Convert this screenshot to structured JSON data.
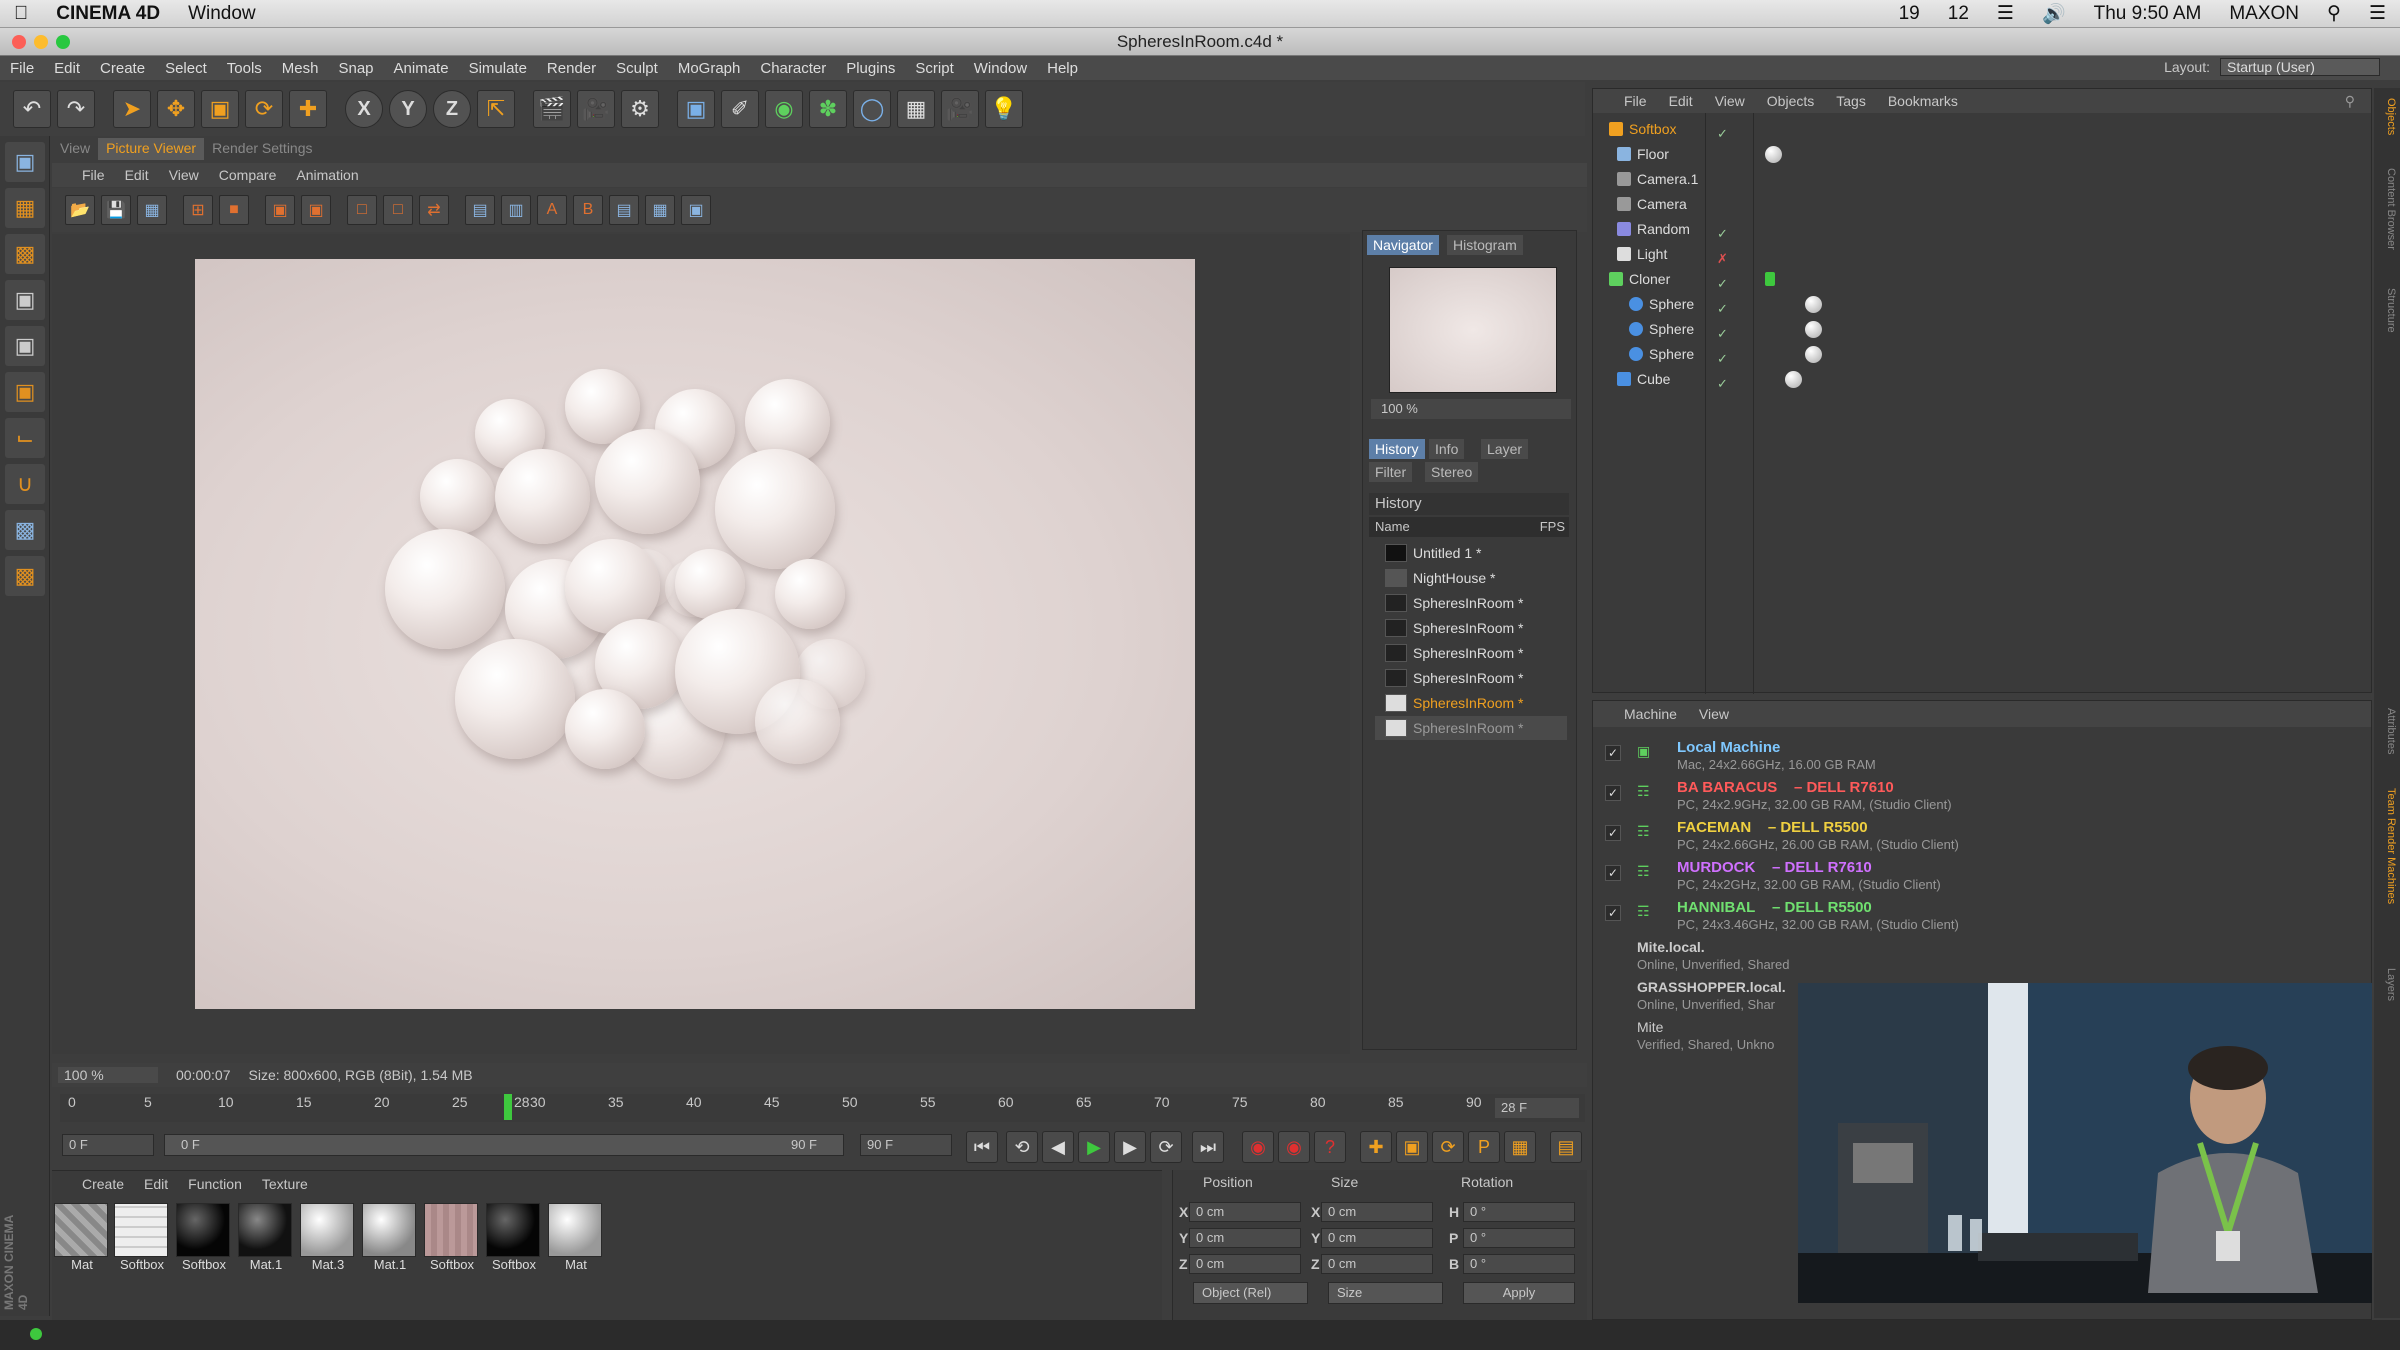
{
  "mac_menubar": {
    "app": "CINEMA 4D",
    "window": "Window",
    "status": [
      "19",
      "12",
      "Thu 9:50 AM",
      "MAXON"
    ]
  },
  "window_title": "SpheresInRoom.c4d *",
  "main_menu": [
    "File",
    "Edit",
    "Create",
    "Select",
    "Tools",
    "Mesh",
    "Snap",
    "Animate",
    "Simulate",
    "Render",
    "Sculpt",
    "MoGraph",
    "Character",
    "Plugins",
    "Script",
    "Window",
    "Help"
  ],
  "layout": {
    "label": "Layout:",
    "value": "Startup (User)"
  },
  "viewer_tabs": [
    "View",
    "Picture Viewer",
    "Render Settings"
  ],
  "viewer_menu": [
    "File",
    "Edit",
    "View",
    "Compare",
    "Animation"
  ],
  "navigator": {
    "tabs": [
      "Navigator",
      "Histogram"
    ],
    "zoom": "100 %",
    "info_tabs": [
      "History",
      "Info",
      "Layer"
    ],
    "info_tabs2": [
      "Filter",
      "Stereo"
    ],
    "history_title": "History",
    "col_name": "Name",
    "col_fps": "FPS",
    "items": [
      "Untitled 1 *",
      "NightHouse *",
      "SpheresInRoom *",
      "SpheresInRoom *",
      "SpheresInRoom *",
      "SpheresInRoom *",
      "SpheresInRoom *",
      "SpheresInRoom *"
    ]
  },
  "status": {
    "zoom": "100 %",
    "time": "00:00:07",
    "size": "Size: 800x600, RGB (8Bit), 1.54 MB"
  },
  "timeline": {
    "ticks": [
      "0",
      "5",
      "10",
      "15",
      "20",
      "25",
      "30",
      "35",
      "40",
      "45",
      "50",
      "55",
      "60",
      "65",
      "70",
      "75",
      "80",
      "85",
      "90"
    ],
    "playhead": "28",
    "current_frame": "28 F",
    "start": "0 F",
    "range_start": "0 F",
    "range_end": "90 F",
    "end": "90 F"
  },
  "materials": {
    "menu": [
      "Create",
      "Edit",
      "Function",
      "Texture"
    ],
    "items": [
      "Mat",
      "Softbox",
      "Softbox",
      "Mat.1",
      "Mat.3",
      "Mat.1",
      "Softbox",
      "Softbox",
      "Mat"
    ]
  },
  "coords": {
    "position": "Position",
    "size": "Size",
    "rotation": "Rotation",
    "x": "X",
    "y": "Y",
    "z": "Z",
    "h": "H",
    "p": "P",
    "b": "B",
    "zero_cm": "0 cm",
    "zero_deg": "0 °",
    "mode": "Object (Rel)",
    "size_mode": "Size",
    "apply": "Apply"
  },
  "objects": {
    "menu": [
      "File",
      "Edit",
      "View",
      "Objects",
      "Tags",
      "Bookmarks"
    ],
    "rows": [
      "Softbox",
      "Floor",
      "Camera.1",
      "Camera",
      "Random",
      "Light",
      "Cloner",
      "Sphere",
      "Sphere",
      "Sphere",
      "Cube"
    ]
  },
  "team": {
    "menu": [
      "Machine",
      "View"
    ],
    "machines": [
      {
        "name": "Local Machine",
        "model": "",
        "detail": "Mac, 24x2.66GHz, 16.00 GB RAM",
        "color": "#7fc8ff"
      },
      {
        "name": "BA BARACUS",
        "model": "– DELL R7610",
        "detail": "PC, 24x2.9GHz, 32.00 GB RAM, (Studio Client)",
        "color": "#ff5a5a"
      },
      {
        "name": "FACEMAN",
        "model": "– DELL R5500",
        "detail": "PC, 24x2.66GHz, 26.00 GB RAM, (Studio Client)",
        "color": "#f0d040"
      },
      {
        "name": "MURDOCK",
        "model": "– DELL R7610",
        "detail": "PC, 24x2GHz, 32.00 GB RAM, (Studio Client)",
        "color": "#d070ff"
      },
      {
        "name": "HANNIBAL",
        "model": "– DELL R5500",
        "detail": "PC, 24x3.46GHz, 32.00 GB RAM, (Studio Client)",
        "color": "#70e070"
      }
    ],
    "others": [
      {
        "name": "Mite.local.",
        "detail": "Online, Unverified, Shared"
      },
      {
        "name": "GRASSHOPPER.local.",
        "detail": "Online, Unverified, Shar"
      },
      {
        "name": "Mite",
        "detail": "Verified, Shared, Unkno"
      }
    ]
  },
  "right_tabs": [
    "Objects",
    "Content Browser",
    "Structure",
    "Attributes",
    "Team Render Machines",
    "Layers"
  ],
  "branding": "MAXON CINEMA 4D"
}
